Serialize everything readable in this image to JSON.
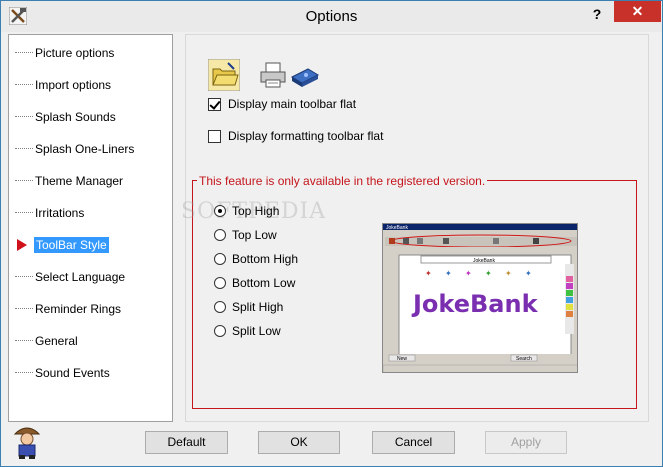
{
  "window": {
    "title": "Options",
    "help_glyph": "?",
    "close_glyph": "✕"
  },
  "nav": {
    "items": [
      {
        "label": "Picture options"
      },
      {
        "label": "Import options"
      },
      {
        "label": "Splash Sounds"
      },
      {
        "label": "Splash One-Liners"
      },
      {
        "label": "Theme Manager"
      },
      {
        "label": "Irritations"
      },
      {
        "label": "ToolBar Style"
      },
      {
        "label": "Select Language"
      },
      {
        "label": "Reminder Rings"
      },
      {
        "label": "General"
      },
      {
        "label": "Sound Events"
      }
    ],
    "selected_index": 6
  },
  "toolbar": {
    "icons": [
      "open-folder-icon",
      "printer-icon",
      "scanner-icon"
    ],
    "main_flat": {
      "label": "Display main toolbar flat",
      "checked": true
    },
    "format_flat": {
      "label": "Display formatting toolbar flat",
      "checked": false
    }
  },
  "registration": {
    "notice": "This feature is only available in the registered version."
  },
  "style_options": [
    {
      "label": "Top High",
      "selected": true
    },
    {
      "label": "Top Low",
      "selected": false
    },
    {
      "label": "Bottom High",
      "selected": false
    },
    {
      "label": "Bottom Low",
      "selected": false
    },
    {
      "label": "Split High",
      "selected": false
    },
    {
      "label": "Split Low",
      "selected": false
    }
  ],
  "preview": {
    "window_title": "JokeBank",
    "header_label": "JokeBank",
    "logo_text": "JokeBank",
    "buttons": [
      "New",
      "Search"
    ]
  },
  "watermark": "SOFTPEDIA",
  "buttons": {
    "default": "Default",
    "ok": "OK",
    "cancel": "Cancel",
    "apply": "Apply"
  },
  "colors": {
    "accent_red": "#c4161c",
    "selection_blue": "#3399ff",
    "close_red": "#c7312a"
  }
}
